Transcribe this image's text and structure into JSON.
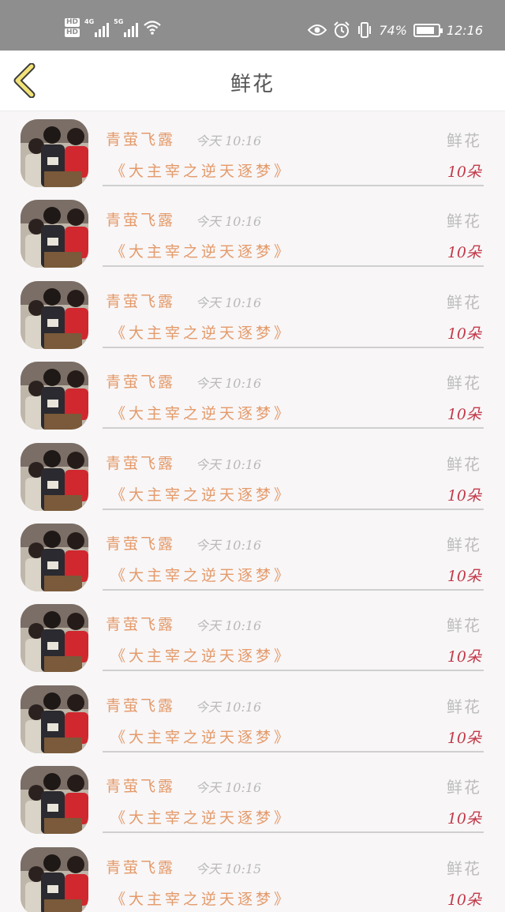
{
  "status_bar": {
    "hd1": "HD",
    "hd2": "HD",
    "net1": "4G",
    "net2": "5G",
    "battery_text": "74%",
    "time": "12:16",
    "icons": [
      "signal-icon",
      "wifi-icon",
      "eye-icon",
      "alarm-icon",
      "vibrate-icon",
      "battery-icon"
    ]
  },
  "nav": {
    "back_icon": "chevron-left-icon",
    "title": "鲜花",
    "back_color": "#f2e27a"
  },
  "records": [
    {
      "user": "青萤飞露",
      "time": "今天 10:16",
      "gift": "鲜花",
      "book": "《大主宰之逆天逐梦》",
      "count": "10朵"
    },
    {
      "user": "青萤飞露",
      "time": "今天 10:16",
      "gift": "鲜花",
      "book": "《大主宰之逆天逐梦》",
      "count": "10朵"
    },
    {
      "user": "青萤飞露",
      "time": "今天 10:16",
      "gift": "鲜花",
      "book": "《大主宰之逆天逐梦》",
      "count": "10朵"
    },
    {
      "user": "青萤飞露",
      "time": "今天 10:16",
      "gift": "鲜花",
      "book": "《大主宰之逆天逐梦》",
      "count": "10朵"
    },
    {
      "user": "青萤飞露",
      "time": "今天 10:16",
      "gift": "鲜花",
      "book": "《大主宰之逆天逐梦》",
      "count": "10朵"
    },
    {
      "user": "青萤飞露",
      "time": "今天 10:16",
      "gift": "鲜花",
      "book": "《大主宰之逆天逐梦》",
      "count": "10朵"
    },
    {
      "user": "青萤飞露",
      "time": "今天 10:16",
      "gift": "鲜花",
      "book": "《大主宰之逆天逐梦》",
      "count": "10朵"
    },
    {
      "user": "青萤飞露",
      "time": "今天 10:16",
      "gift": "鲜花",
      "book": "《大主宰之逆天逐梦》",
      "count": "10朵"
    },
    {
      "user": "青萤飞露",
      "time": "今天 10:16",
      "gift": "鲜花",
      "book": "《大主宰之逆天逐梦》",
      "count": "10朵"
    },
    {
      "user": "青萤飞露",
      "time": "今天 10:15",
      "gift": "鲜花",
      "book": "《大主宰之逆天逐梦》",
      "count": "10朵"
    }
  ],
  "colors": {
    "status_bg": "#8e8e8e",
    "name_color": "#e49a6a",
    "count_color": "#c23a4a",
    "muted": "#bcbcbc"
  }
}
